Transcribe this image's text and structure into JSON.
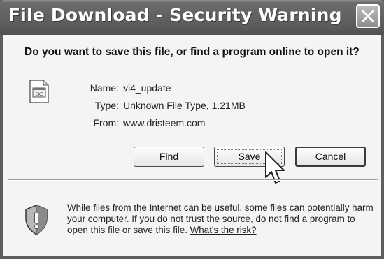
{
  "window": {
    "title": "File Download - Security Warning"
  },
  "dialog": {
    "question": "Do you want to save this file, or find a program online to open it?",
    "file": {
      "name_label": "Name:",
      "name_value": "vl4_update",
      "type_label": "Type:",
      "type_value": "Unknown File Type, 1.21MB",
      "from_label": "From:",
      "from_value": "www.dristeem.com"
    },
    "buttons": {
      "find_mnemonic": "F",
      "find_rest": "ind",
      "save_mnemonic": "S",
      "save_rest": "ave",
      "cancel": "Cancel"
    },
    "warning": {
      "text": "While files from the Internet can be useful, some files can potentially harm your computer. If you do not trust the source, do not find a program to open this file or save this file.",
      "link": "What's the risk?"
    }
  },
  "icons": {
    "close": "close-icon",
    "file": "unknown-file-icon",
    "shield": "security-shield-icon",
    "cursor": "mouse-pointer-icon"
  }
}
